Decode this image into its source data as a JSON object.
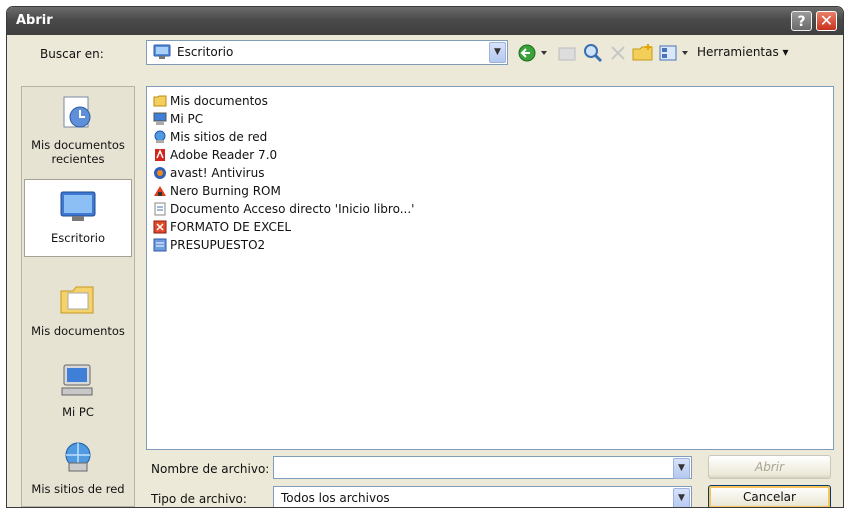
{
  "window": {
    "title": "Abrir"
  },
  "titlebar": {
    "help_label": "?",
    "close_label": "✕"
  },
  "toolbar": {
    "look_in_label": "Buscar en:",
    "look_in_value": "Escritorio",
    "tools_label": "Herramientas ▾"
  },
  "places": [
    {
      "label": "Mis documentos recientes",
      "icon": "recent-docs-icon"
    },
    {
      "label": "Escritorio",
      "icon": "desktop-icon",
      "selected": true
    },
    {
      "label": "Mis documentos",
      "icon": "my-documents-icon"
    },
    {
      "label": "Mi PC",
      "icon": "my-computer-icon"
    },
    {
      "label": "Mis sitios de red",
      "icon": "network-places-icon"
    }
  ],
  "files": [
    {
      "name": "Mis documentos",
      "icon": "folder-icon"
    },
    {
      "name": "Mi PC",
      "icon": "computer-icon"
    },
    {
      "name": "Mis sitios de red",
      "icon": "network-icon"
    },
    {
      "name": "Adobe Reader 7.0",
      "icon": "adobe-reader-icon"
    },
    {
      "name": "avast! Antivirus",
      "icon": "avast-icon"
    },
    {
      "name": "Nero Burning ROM",
      "icon": "nero-icon"
    },
    {
      "name": "Documento Acceso directo 'Inicio libro...'",
      "icon": "shortcut-icon"
    },
    {
      "name": "FORMATO DE EXCEL",
      "icon": "excel-file-icon"
    },
    {
      "name": "PRESUPUESTO2",
      "icon": "document-file-icon"
    }
  ],
  "bottom": {
    "filename_label": "Nombre de archivo:",
    "filename_value": "",
    "filetype_label": "Tipo de archivo:",
    "filetype_value": "Todos los archivos",
    "open_label": "Abrir",
    "cancel_label": "Cancelar"
  }
}
